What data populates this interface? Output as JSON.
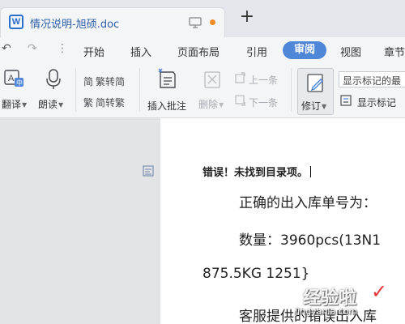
{
  "window": {
    "doc_tab_title": "情况说明-旭硕.doc",
    "new_tab": "+",
    "unsaved_color": "#f08a24"
  },
  "menubar": {
    "undo": "↶",
    "redo": "↷",
    "more": "⋮",
    "items": [
      "开始",
      "插入",
      "页面布局",
      "引用",
      "审阅",
      "视图",
      "章节"
    ],
    "active": "审阅",
    "active_color": "#4e86d8"
  },
  "ribbon": {
    "translate": "翻译",
    "read_aloud": "朗读",
    "trad_to_simp": "繁转简",
    "simp_to_trad": "简转繁",
    "insert_comment": "插入批注",
    "delete": "删除",
    "prev": "上一条",
    "next": "下一条",
    "revise": "修订",
    "show_markup_select": "显示标记的最",
    "show_markup": "显示标记"
  },
  "document": {
    "line1": "错误！未找到目录项。",
    "line2": "正确的出入库单号为：",
    "line3": "数量：3960pcs(13N1",
    "line4": "875.5KG    1251}",
    "line5": "客服提供的错误出入库"
  },
  "watermark": {
    "text": "经验啦",
    "check": "✓",
    "url": "jingyanla.com"
  }
}
